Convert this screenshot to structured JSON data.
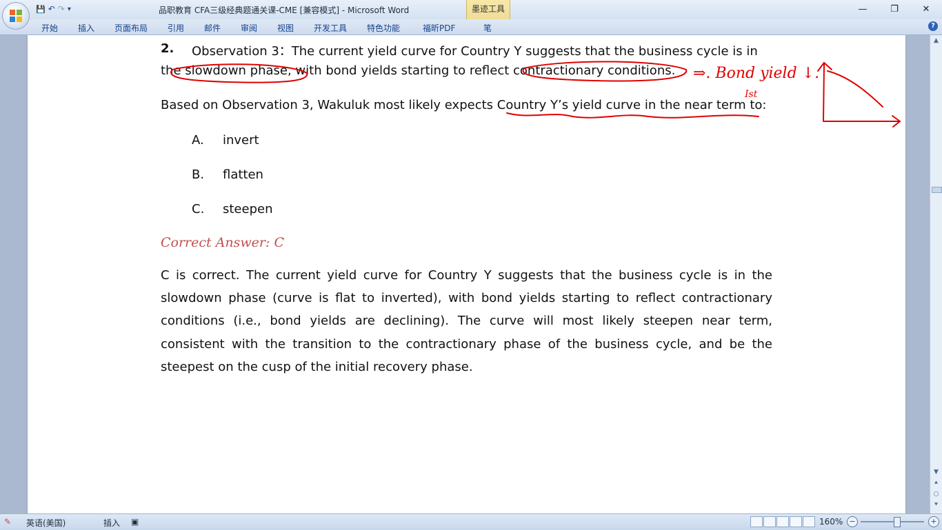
{
  "window": {
    "title": "品职教育 CFA三级经典题通关课-CME [兼容模式] - Microsoft Word",
    "contextual_tab_group": "墨迹工具",
    "controls": {
      "minimize": "—",
      "maximize": "❐",
      "close": "✕"
    }
  },
  "quick_access": {
    "save": "💾",
    "undo": "↶",
    "redo": "↷",
    "more": "▾"
  },
  "ribbon": {
    "tabs": [
      "开始",
      "插入",
      "页面布局",
      "引用",
      "邮件",
      "审阅",
      "视图",
      "开发工具",
      "特色功能",
      "福昕PDF",
      "笔"
    ],
    "help": "?"
  },
  "document": {
    "question_number": "2.",
    "observation_line1": "Observation 3：The current yield curve for Country Y suggests that the business cycle is in",
    "observation_line2": "the slowdown phase, with bond yields starting to reflect contractionary conditions.",
    "prompt": "Based on Observation 3, Wakuluk most likely expects Country Y’s yield curve in the near term to:",
    "options": [
      {
        "letter": "A.",
        "text": "invert"
      },
      {
        "letter": "B.",
        "text": "flatten"
      },
      {
        "letter": "C.",
        "text": "steepen"
      }
    ],
    "correct_answer": "Correct Answer: C",
    "explanation": "C is correct. The current yield curve for Country Y suggests that the business cycle is in the slowdown phase (curve is flat to inverted), with bond yields starting to reflect contractionary conditions (i.e., bond yields are declining). The curve will most likely steepen near term, consistent with the transition to the contractionary phase of the business cycle, and be the steepest on the cusp of the initial recovery phase.",
    "handwriting": {
      "note1": "⇒. Bond yield ↓.",
      "note2": "Ist"
    },
    "ink_color": "#e00000"
  },
  "statusbar": {
    "language": "英语(美国)",
    "insert_mode": "插入",
    "zoom": "160%"
  },
  "colors": {
    "answer": "#c0504d",
    "accent": "#15428b"
  }
}
